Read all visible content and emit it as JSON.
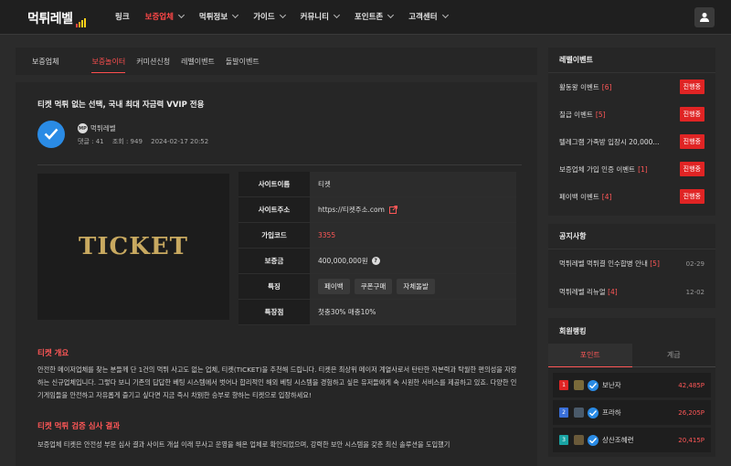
{
  "brand": {
    "logo_text": "먹튀레벨",
    "bar_colors": [
      "#ff4747",
      "#ff9f1a",
      "#ffd21a",
      "#ffd21a"
    ]
  },
  "nav": {
    "items": [
      {
        "label": "링크",
        "dropdown": false,
        "active": false
      },
      {
        "label": "보증업체",
        "dropdown": true,
        "active": true
      },
      {
        "label": "먹튀정보",
        "dropdown": true,
        "active": false
      },
      {
        "label": "가이드",
        "dropdown": true,
        "active": false
      },
      {
        "label": "커뮤니티",
        "dropdown": true,
        "active": false
      },
      {
        "label": "포인트존",
        "dropdown": true,
        "active": false
      },
      {
        "label": "고객센터",
        "dropdown": true,
        "active": false
      }
    ],
    "user_icon": "user-icon"
  },
  "subnav": {
    "heading": "보증업체",
    "tabs": [
      {
        "label": "보증놀이터",
        "active": true
      },
      {
        "label": "커미션신청",
        "active": false
      },
      {
        "label": "레벨이벤트",
        "active": false
      },
      {
        "label": "돌발이벤트",
        "active": false
      }
    ]
  },
  "post": {
    "title": "티켓 먹튀 없는 선택, 국내 최대 자금력 VVIP 전용",
    "author_badge": "MP",
    "author": "먹튀레벨",
    "comments": "댓글 : 41",
    "views": "조회 : 949",
    "date": "2024-02-17 20:52",
    "banner_text": "TICKET",
    "info": {
      "site_name_label": "사이트이름",
      "site_name": "티켓",
      "site_url_label": "사이트주소",
      "site_url": "https://티켓주소.com",
      "join_code_label": "가입코드",
      "join_code": "3355",
      "deposit_label": "보증금",
      "deposit": "400,000,000원",
      "features_label": "특징",
      "features": [
        "페이백",
        "쿠폰구매",
        "자체돌발"
      ],
      "special_label": "특장점",
      "special": "첫충30% 매충10%"
    },
    "section1_title": "티켓 개요",
    "section1_body": "안전한 메이저업체를 찾는 분들께 단 1건의 먹튀 사고도 없는 업체, 티켓(TICKET)을 추천해 드립니다. 티켓은 최상위 메이저 계열사로서 탄탄한 자본력과 탁월한 편의성을 자랑하는 신규업체입니다. 그렇다 보니 기존의 답답한 베팅 시스템에서 벗어나 합리적인 해외 베팅 시스템을 경험하고 싶은 유저들에게 속 시원한 서비스를 제공하고 있죠. 다양한 인기게임들을 안전하고 자유롭게 즐기고 싶다면 지금 즉시 차別한 승부로 향하는 티켓으로 입장하세요!",
    "section2_title": "티켓 먹튀 검증 심사 결과",
    "section2_body": "보증업체 티켓은 안전성 부문 심사 결과 사이트 개설 이래 무사고 운영을 해온 업체로 확인되었으며, 강력한 보안 시스템을 갖춘 최신 솔루션을 도입했기"
  },
  "sidebar": {
    "level_events": {
      "title": "레벨이벤트",
      "items": [
        {
          "label": "활동왕 이벤트",
          "count": "[6]",
          "badge": "진행중"
        },
        {
          "label": "칠급 이벤트",
          "count": "[5]",
          "badge": "진행중"
        },
        {
          "label": "텔레그램 가족방 입장시 20,000...",
          "count": "",
          "badge": "진행중"
        },
        {
          "label": "보증업체 가입 인증 이벤트",
          "count": "[1]",
          "badge": "진행중"
        },
        {
          "label": "페이백 이벤트",
          "count": "[4]",
          "badge": "진행중"
        }
      ]
    },
    "notices": {
      "title": "공지사항",
      "items": [
        {
          "label": "먹튀레벨 먹튀결 인수합병 안내",
          "count": "[5]",
          "date": "02-29"
        },
        {
          "label": "먹튀레벨 리뉴얼",
          "count": "[4]",
          "date": "12-02"
        }
      ]
    },
    "ranking": {
      "title": "회원랭킹",
      "tabs": [
        "포인트",
        "계급"
      ],
      "active_tab": 0,
      "items": [
        {
          "rank": "1",
          "name": "보난자",
          "points": "42,485P",
          "rank_color": "#e02424",
          "level_color": "#7a6a3a"
        },
        {
          "rank": "2",
          "name": "프라하",
          "points": "26,205P",
          "rank_color": "#3a6fd8",
          "level_color": "#4a5a6a"
        },
        {
          "rank": "3",
          "name": "상산조혜련",
          "points": "20,415P",
          "rank_color": "#19a3a3",
          "level_color": "#6a5a3a"
        }
      ]
    }
  }
}
